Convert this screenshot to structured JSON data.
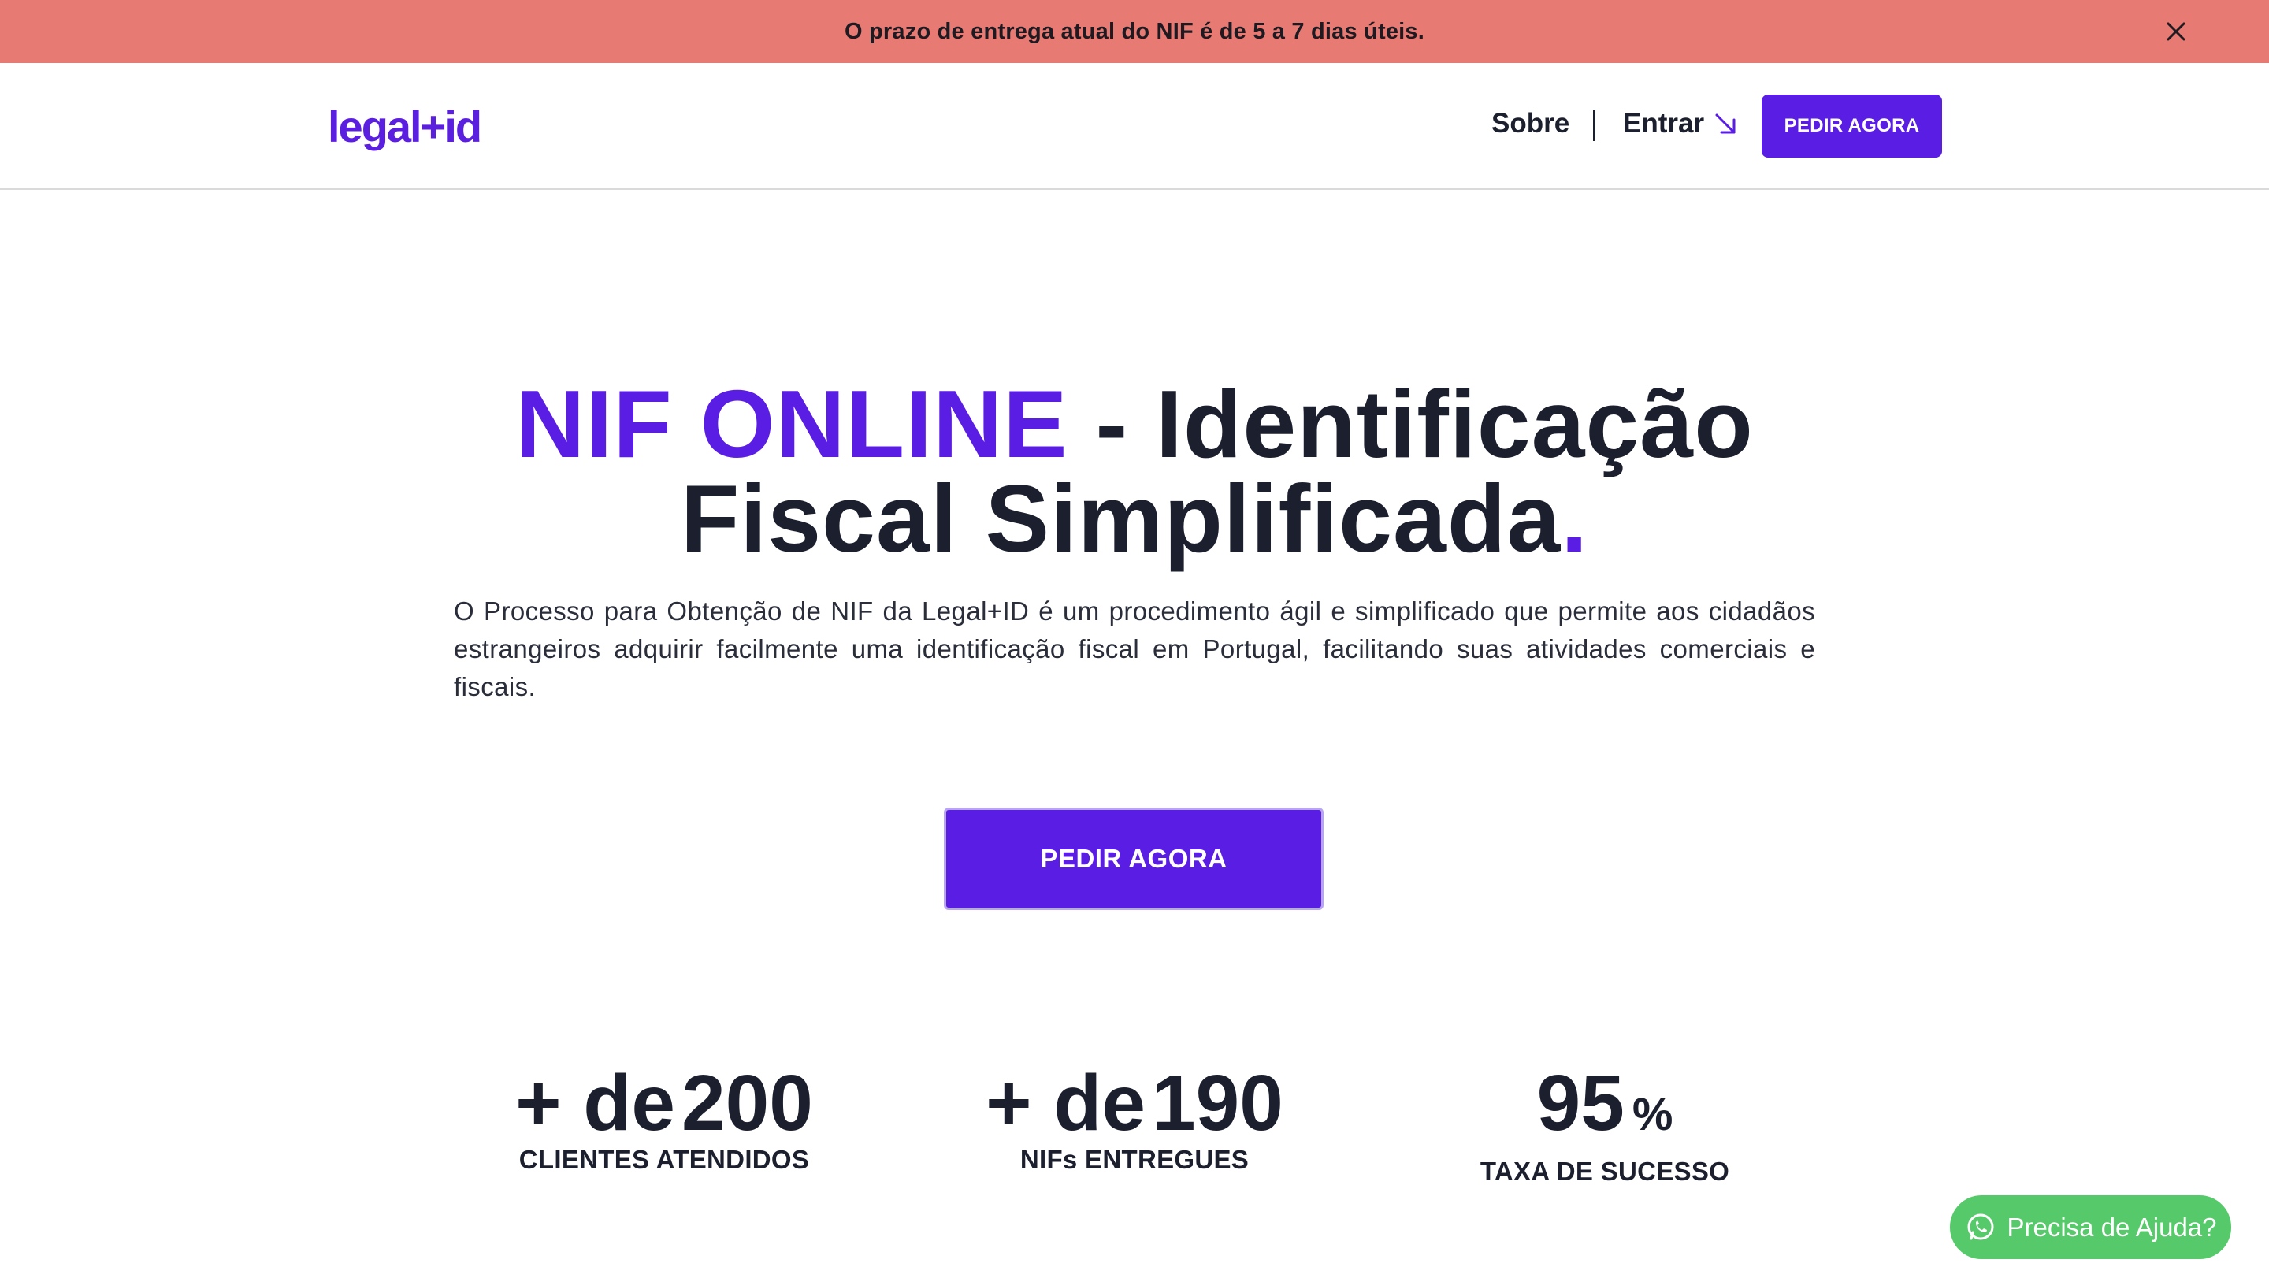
{
  "announcement": {
    "text": "O prazo de entrega atual do NIF é de 5 a 7 dias úteis.",
    "close_icon": "close-icon"
  },
  "nav": {
    "logo": "legal+id",
    "about": "Sobre",
    "login": "Entrar",
    "cta": "PEDIR AGORA"
  },
  "hero": {
    "title_accent": "NIF ONLINE",
    "title_rest_1": " - Identificação",
    "title_rest_2": "Fiscal Simplificada",
    "title_dot": ".",
    "description": "O Processo para Obtenção de NIF da Legal+ID é um procedimento ágil e simplificado que permite aos cidadãos estrangeiros adquirir facilmente uma identificação fiscal em Portugal, facilitando suas atividades comerciais e fiscais.",
    "cta": "PEDIR AGORA"
  },
  "stats": [
    {
      "prefix": "+ de",
      "value": "200",
      "suffix": "",
      "label": "CLIENTES ATENDIDOS"
    },
    {
      "prefix": "+ de",
      "value": "190",
      "suffix": "",
      "label": "NIFs ENTREGUES"
    },
    {
      "prefix": "",
      "value": "95",
      "suffix": "%",
      "label": "TAXA DE SUCESSO"
    }
  ],
  "help": {
    "label": "Precisa de Ajuda?",
    "icon": "whatsapp-icon"
  },
  "colors": {
    "brand": "#5a1de3",
    "announcement_bg": "#e77a72",
    "help_bg": "#56c96a",
    "text": "#1b1f2e"
  }
}
